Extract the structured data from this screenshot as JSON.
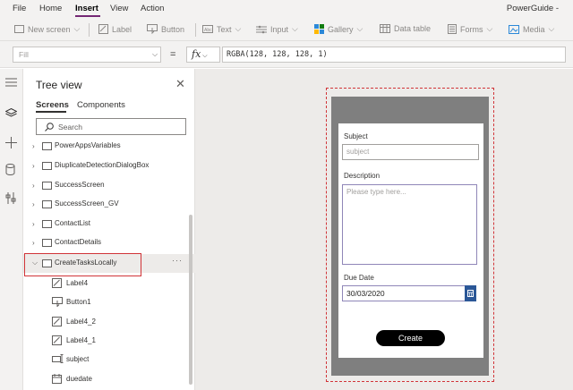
{
  "menubar": {
    "items": [
      "File",
      "Home",
      "Insert",
      "View",
      "Action"
    ],
    "active": "Insert",
    "app_name": "PowerGuide -"
  },
  "ribbon": {
    "new_screen": "New screen",
    "label": "Label",
    "button": "Button",
    "text": "Text",
    "input": "Input",
    "gallery": "Gallery",
    "data_table": "Data table",
    "forms": "Forms",
    "media": "Media"
  },
  "formula_bar": {
    "property": "Fill",
    "equals": "=",
    "fx": "fx",
    "formula": "RGBA(128, 128, 128, 1)"
  },
  "tree_view": {
    "title": "Tree view",
    "tabs": [
      "Screens",
      "Components"
    ],
    "search_placeholder": "Search",
    "screens": [
      "PowerAppsVariables",
      "DiuplicateDetectionDialogBox",
      "SuccessScreen",
      "SuccessScreen_GV",
      "ContactList",
      "ContactDetails",
      "CreateTasksLocally"
    ],
    "selected_screen": "CreateTasksLocally",
    "more": "···",
    "children": [
      {
        "label": "Label4",
        "icon": "label-icon"
      },
      {
        "label": "Button1",
        "icon": "button-icon"
      },
      {
        "label": "Label4_2",
        "icon": "label-icon"
      },
      {
        "label": "Label4_1",
        "icon": "label-icon"
      },
      {
        "label": "subject",
        "icon": "text-input-icon"
      },
      {
        "label": "duedate",
        "icon": "calendar-icon"
      }
    ]
  },
  "form": {
    "subject_label": "Subject",
    "subject_placeholder": "subject",
    "description_label": "Description",
    "description_placeholder": "Please type here...",
    "due_date_label": "Due Date",
    "due_date_value": "30/03/2020",
    "create_button": "Create"
  },
  "colors": {
    "accent": "#742774",
    "selection": "#d13438",
    "device_fill": "#7f7f7f",
    "date_button": "#2b5797"
  }
}
